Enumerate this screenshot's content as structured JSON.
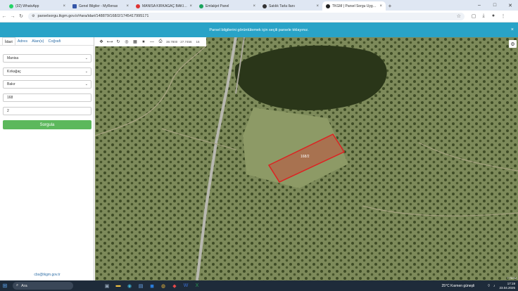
{
  "browser": {
    "tabs": [
      {
        "label": "(32) WhatsApp",
        "color": "#25d366",
        "active": false
      },
      {
        "label": "Genel Bilgiler - MyRenax",
        "color": "#3556a8",
        "active": false
      },
      {
        "label": "MANISA KIRKAĞAÇ BAKIR'DA",
        "color": "#d33",
        "active": false
      },
      {
        "label": "Emlakjet Panel",
        "color": "#1aa35c",
        "active": false
      },
      {
        "label": "Satılık Tarla İlanı",
        "color": "#333",
        "active": false
      },
      {
        "label": "TKGM | Parsel Sorgu Uygulama",
        "color": "#222",
        "active": true
      }
    ],
    "url": "parselsorgu.tkgm.gov.tr/#ara/idari/148879/168/2/1745417995171"
  },
  "banner": {
    "text": "Parsel bilgilerini görüntülemek için seçili parsele tıklayınız."
  },
  "sidebar": {
    "tabs": [
      "İdari",
      "Adres",
      "Alan(s)",
      "Coğrafi"
    ],
    "province": "Manisa",
    "district": "Kırkağaç",
    "neighborhood": "Bakır",
    "block": "168",
    "parcel": "2",
    "query_label": "Sorgula",
    "email": "cbs@tkgm.gov.tr"
  },
  "map": {
    "coordinates": "38.7800 · 27.7456",
    "zoom": "16",
    "parcel_label": "168/2",
    "attribution": "© TKGM"
  },
  "taskbar": {
    "search_label": "Ara",
    "weather": "25°C  Kısmen güneşli",
    "time": "17:19",
    "date": "23.04.2025"
  }
}
